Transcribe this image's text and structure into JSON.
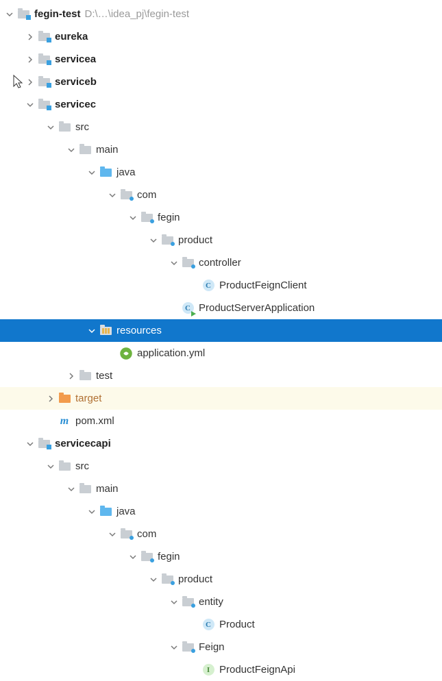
{
  "root": {
    "name": "fegin-test",
    "path": "D:\\…\\idea_pj\\fegin-test"
  },
  "modules": {
    "eureka": "eureka",
    "servicea": "servicea",
    "serviceb": "serviceb",
    "servicec": "servicec",
    "servicecapi": "servicecapi"
  },
  "folders": {
    "src": "src",
    "main": "main",
    "java": "java",
    "com": "com",
    "fegin": "fegin",
    "product": "product",
    "controller": "controller",
    "resources": "resources",
    "test": "test",
    "target": "target",
    "entity": "entity",
    "feign": "Feign"
  },
  "files": {
    "productFeignClient": "ProductFeignClient",
    "productServerApplication": "ProductServerApplication",
    "applicationYml": "application.yml",
    "pomXml": "pom.xml",
    "product": "Product",
    "productFeignApi": "ProductFeignApi"
  },
  "iconLetters": {
    "class": "C",
    "interface": "I",
    "maven": "m"
  }
}
